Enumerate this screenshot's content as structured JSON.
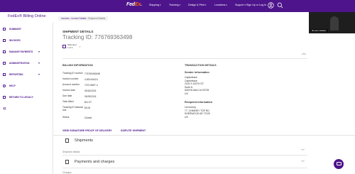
{
  "header": {
    "logo_fed": "Fed",
    "logo_ex": "Ex",
    "logo_suffix": ".",
    "menu": [
      "Shipping",
      "Tracking",
      "Design & Print",
      "Locations",
      "Support"
    ],
    "menu_chevron": "▾",
    "sign_in": "Sign Up or Log In",
    "brand_color": "#4d148c",
    "accent_color": "#ff6600"
  },
  "app_title": "FedEx® Billing Online",
  "breadcrumb": {
    "items": [
      "Invoices",
      "Invoice Details",
      "Shipment Details"
    ],
    "separator": "›"
  },
  "sidebar": {
    "items": [
      {
        "label": "SUMMARY",
        "icon": "summary-icon",
        "chevron": ""
      },
      {
        "label": "INVOICES",
        "icon": "invoices-icon",
        "chevron": ""
      },
      {
        "label": "MANAGE PAYMENTS",
        "icon": "payments-icon",
        "chevron": "▾"
      },
      {
        "label": "ADMINISTRATION",
        "icon": "admin-icon",
        "chevron": "▾"
      },
      {
        "label": "REPORTING",
        "icon": "reporting-icon",
        "chevron": "▾"
      },
      {
        "label": "HELP",
        "icon": "help-icon",
        "chevron": ""
      },
      {
        "label": "RETURN TO LEGACY",
        "icon": "legacy-icon",
        "chevron": ""
      }
    ],
    "collapse_glyph": "«"
  },
  "main": {
    "section_title": "SHIPMENT DETAILS",
    "tracking_title": "Tracking ID: 776769363498",
    "shipment_label": "Shipment",
    "shipment_count": "1 of 1",
    "shipment_chevron": "›",
    "collapse_glyph": "︿",
    "billing_title": "BILLING INFORMATION",
    "billing_rows": [
      {
        "label": "Tracking ID number",
        "value": "776769363498"
      },
      {
        "label": "Invoice number",
        "value": "4-800-84424"
      },
      {
        "label": "Account number",
        "value": "7270-9857-4"
      },
      {
        "label": "Invoice date",
        "value": "05/16/2024"
      },
      {
        "label": "Due date",
        "value": "05/29/2024"
      },
      {
        "label": "Total billed",
        "value": "$12.37"
      },
      {
        "label": "Tracking ID balance due",
        "value": "$0.00"
      },
      {
        "label": "Status",
        "value": "Closed"
      }
    ],
    "transaction_title": "TRANSACTION DETAILS",
    "sender": {
      "title": "Sender information",
      "lines": [
        "Captivelane",
        "Captivelane",
        "2115 S 105TH ST",
        "Suite N",
        "SANTA ANA CA 92705",
        "US"
      ]
    },
    "recipient": {
      "title": "Recipient information",
      "lines": [
        "Lai murray",
        "77, CHIMNEY TOP RD",
        "SHERWOOD AR 72120",
        "US"
      ]
    },
    "link_signature": "VIEW SIGNATURE PROOF OF DELIVERY",
    "link_dispute": "DISPUTE SHIPMENT",
    "shipments_title": "Shipments",
    "shipment_details_sub": "Shipment details",
    "payments_title": "Payments and charges",
    "more_sub": "Charges",
    "expand_glyph": "﹀"
  },
  "video": {
    "name": "Roman Vasiliev"
  }
}
